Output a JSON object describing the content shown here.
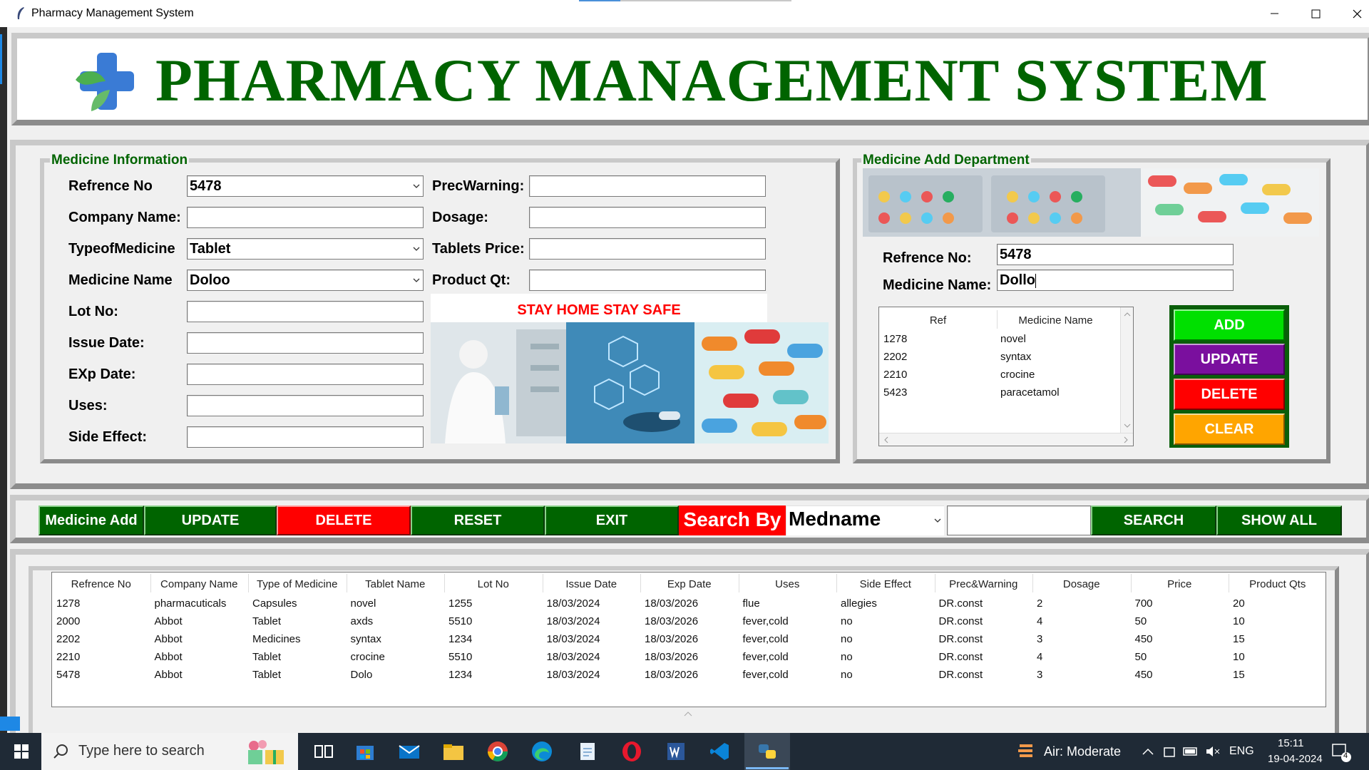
{
  "window": {
    "title": "Pharmacy Management System"
  },
  "header": {
    "title": "PHARMACY MANAGEMENT SYSTEM"
  },
  "medicine_info": {
    "section_title": "Medicine Information",
    "labels": {
      "ref_no": "Refrence No",
      "company_name": "Company Name:",
      "type_of_medicine": "TypeofMedicine",
      "medicine_name": "Medicine Name",
      "lot_no": "Lot No:",
      "issue_date": "Issue Date:",
      "exp_date": "EXp Date:",
      "uses": "Uses:",
      "side_effect": "Side Effect:",
      "prec_warning": "PrecWarning:",
      "dosage": "Dosage:",
      "tablets_price": "Tablets Price:",
      "product_qt": "Product Qt:"
    },
    "values": {
      "ref_no": "5478",
      "company_name": "",
      "type_of_medicine": "Tablet",
      "medicine_name": "Doloo",
      "lot_no": "",
      "issue_date": "",
      "exp_date": "",
      "uses": "",
      "side_effect": "",
      "prec_warning": "",
      "dosage": "",
      "tablets_price": "",
      "product_qt": ""
    },
    "banner": "STAY HOME STAY SAFE"
  },
  "add_department": {
    "section_title": "Medicine Add Department",
    "labels": {
      "ref_no": "Refrence No:",
      "medicine_name": "Medicine Name:"
    },
    "values": {
      "ref_no": "5478",
      "medicine_name": "Dollo"
    },
    "table": {
      "columns": [
        "Ref",
        "Medicine Name"
      ],
      "rows": [
        [
          "1278",
          "novel"
        ],
        [
          "2202",
          "syntax"
        ],
        [
          "2210",
          "crocine"
        ],
        [
          "5423",
          "paracetamol"
        ]
      ]
    },
    "buttons": {
      "add": "ADD",
      "update": "UPDATE",
      "delete": "DELETE",
      "clear": "CLEAR"
    },
    "colors": {
      "add": "#00e000",
      "update": "#7a0f9e",
      "delete": "#ff0000",
      "clear": "#ffa500"
    }
  },
  "toolbar": {
    "medicine_add": "Medicine Add",
    "update": "UPDATE",
    "delete": "DELETE",
    "reset": "RESET",
    "exit": "EXIT",
    "search_by": "Search By",
    "search_by_value": "Medname",
    "search_text": "",
    "search": "SEARCH",
    "show_all": "SHOW ALL"
  },
  "records": {
    "columns": [
      "Refrence No",
      "Company Name",
      "Type of Medicine",
      "Tablet Name",
      "Lot No",
      "Issue Date",
      "Exp Date",
      "Uses",
      "Side Effect",
      "Prec&Warning",
      "Dosage",
      "Price",
      "Product Qts"
    ],
    "rows": [
      [
        "1278",
        "pharmacuticals",
        "Capsules",
        "novel",
        "1255",
        "18/03/2024",
        "18/03/2026",
        "flue",
        "allegies",
        "DR.const",
        "2",
        "700",
        "20"
      ],
      [
        "2000",
        "Abbot",
        "Tablet",
        "axds",
        "5510",
        "18/03/2024",
        "18/03/2026",
        "fever,cold",
        "no",
        "DR.const",
        "4",
        "50",
        "10"
      ],
      [
        "2202",
        "Abbot",
        "Medicines",
        "syntax",
        "1234",
        "18/03/2024",
        "18/03/2026",
        "fever,cold",
        "no",
        "DR.const",
        "3",
        "450",
        "15"
      ],
      [
        "2210",
        "Abbot",
        "Tablet",
        "crocine",
        "5510",
        "18/03/2024",
        "18/03/2026",
        "fever,cold",
        "no",
        "DR.const",
        "4",
        "50",
        "10"
      ],
      [
        "5478",
        "Abbot",
        "Tablet",
        "Dolo",
        "1234",
        "18/03/2024",
        "18/03/2026",
        "fever,cold",
        "no",
        "DR.const",
        "3",
        "450",
        "15"
      ]
    ]
  },
  "taskbar": {
    "search_placeholder": "Type here to search",
    "weather": "Air: Moderate",
    "language": "ENG",
    "time": "15:11",
    "date": "19-04-2024",
    "notifications": "4"
  }
}
